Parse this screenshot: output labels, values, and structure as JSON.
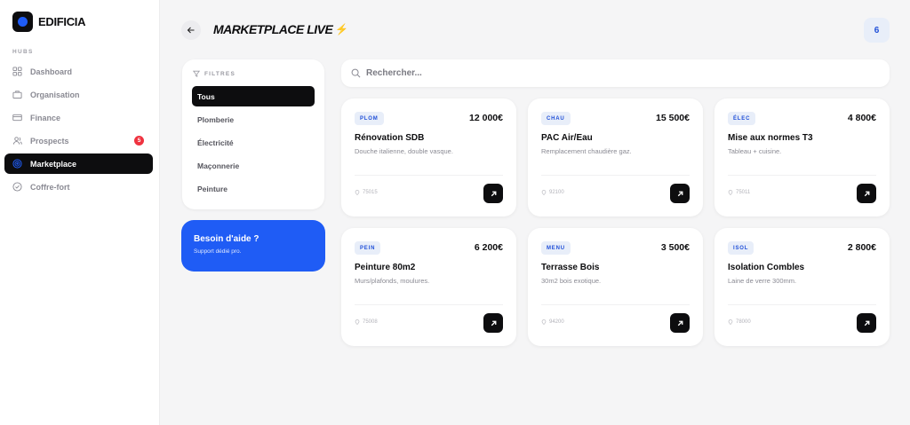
{
  "brand": {
    "name": "EDIFICIA"
  },
  "sidebar": {
    "section_label": "HUBS",
    "items": [
      {
        "label": "Dashboard",
        "icon": "grid-icon"
      },
      {
        "label": "Organisation",
        "icon": "briefcase-icon"
      },
      {
        "label": "Finance",
        "icon": "credit-card-icon"
      },
      {
        "label": "Prospects",
        "icon": "users-icon",
        "badge": "5"
      },
      {
        "label": "Marketplace",
        "icon": "target-icon",
        "active": true
      },
      {
        "label": "Coffre-fort",
        "icon": "check-circle-icon"
      }
    ]
  },
  "header": {
    "title": "MARKETPLACE LIVE",
    "count": "6"
  },
  "filters": {
    "heading": "FILTRES",
    "items": [
      "Tous",
      "Plomberie",
      "Électricité",
      "Maçonnerie",
      "Peinture"
    ],
    "active": "Tous"
  },
  "help": {
    "title": "Besoin d'aide ?",
    "subtitle": "Support dédié pro."
  },
  "search": {
    "placeholder": "Rechercher..."
  },
  "cards": [
    {
      "tag": "PLOM",
      "price": "12 000€",
      "title": "Rénovation SDB",
      "desc": "Douche italienne, double vasque.",
      "loc": "75015"
    },
    {
      "tag": "CHAU",
      "price": "15 500€",
      "title": "PAC Air/Eau",
      "desc": "Remplacement chaudière gaz.",
      "loc": "92100"
    },
    {
      "tag": "ÉLEC",
      "price": "4 800€",
      "title": "Mise aux normes T3",
      "desc": "Tableau + cuisine.",
      "loc": "75011"
    },
    {
      "tag": "PEIN",
      "price": "6 200€",
      "title": "Peinture 80m2",
      "desc": "Murs/plafonds, moulures.",
      "loc": "75008"
    },
    {
      "tag": "MENU",
      "price": "3 500€",
      "title": "Terrasse Bois",
      "desc": "30m2 bois exotique.",
      "loc": "94200"
    },
    {
      "tag": "ISOL",
      "price": "2 800€",
      "title": "Isolation Combles",
      "desc": "Laine de verre 300mm.",
      "loc": "78000"
    }
  ],
  "colors": {
    "accent": "#1f5cf5",
    "dark": "#0d0d0f",
    "badge": "#ef3340",
    "bolt": "#f2b705"
  }
}
